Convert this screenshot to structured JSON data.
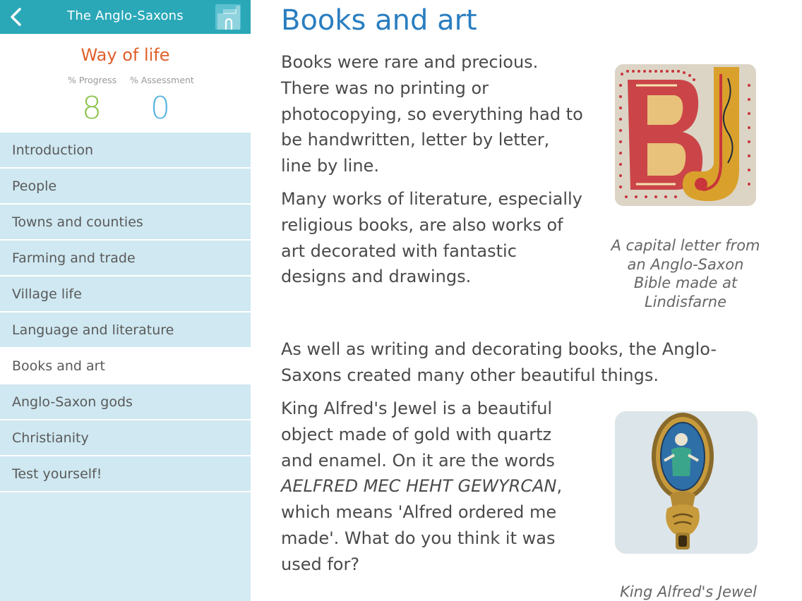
{
  "topbar": {
    "title": "The Anglo-Saxons",
    "back_icon": "chevron-left-icon",
    "home_icon": "castle-icon",
    "color": "#2aa8b8"
  },
  "header": {
    "section_title": "Way of life",
    "progress_label": "% Progress",
    "progress_value": "8",
    "assessment_label": "% Assessment",
    "assessment_value": "0"
  },
  "menu": [
    {
      "label": "Introduction",
      "active": false
    },
    {
      "label": "People",
      "active": false
    },
    {
      "label": "Towns and counties",
      "active": false
    },
    {
      "label": "Farming and trade",
      "active": false
    },
    {
      "label": "Village life",
      "active": false
    },
    {
      "label": "Language and literature",
      "active": false
    },
    {
      "label": "Books and art",
      "active": true
    },
    {
      "label": "Anglo-Saxon gods",
      "active": false
    },
    {
      "label": "Christianity",
      "active": false
    },
    {
      "label": "Test yourself!",
      "active": false
    }
  ],
  "main": {
    "title": "Books and art",
    "p1": "Books were rare and precious. There was no printing or photocopying, so everything had to be handwritten, letter by letter, line by line.",
    "p2": "Many works of literature, especially religious books, are also works of art decorated with fantastic designs and drawings.",
    "p3": "As well as writing and decorating books, the Anglo-Saxons created many other beautiful things.",
    "p4_a": "King Alfred's Jewel is a beautiful object made of gold with quartz and enamel. On it are the words ",
    "p4_italic": "AELFRED MEC HEHT GEWYRCAN",
    "p4_b": ", which means 'Alfred ordered me made'. What do you think it was used for?",
    "caption1": "A capital letter from an Anglo-Saxon Bible made at Lindisfarne",
    "caption2": "King Alfred's Jewel"
  }
}
